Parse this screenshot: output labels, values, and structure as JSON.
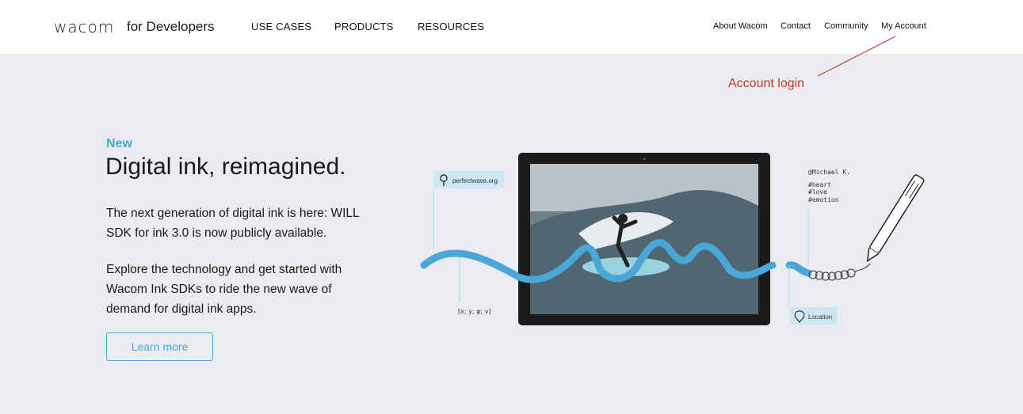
{
  "header": {
    "logo": "wacom",
    "logo_sub": "for Developers",
    "nav": [
      "USE CASES",
      "PRODUCTS",
      "RESOURCES"
    ],
    "util": [
      "About Wacom",
      "Contact",
      "Community",
      "My Account"
    ]
  },
  "annotation": {
    "text": "Account login",
    "color": "#c0392b"
  },
  "hero": {
    "kicker": "New",
    "headline": "Digital ink, reimagined.",
    "para1": "The next generation of digital ink is here: WILL SDK for ink 3.0 is now publicly available.",
    "para2": "Explore the technology and get started with Wacom Ink SDKs to ride the new wave of demand for digital ink apps.",
    "button": "Learn more"
  },
  "illustration": {
    "tag_url": "perfectwave.org",
    "tag_coords": "[x; y; φ; v]",
    "tag_location": "Location",
    "author": "@Michael K.",
    "hashtags": [
      "#heart",
      "#love",
      "#emotion"
    ]
  },
  "colors": {
    "accent": "#4aa7d8",
    "hero_bg": "#ebecef"
  }
}
